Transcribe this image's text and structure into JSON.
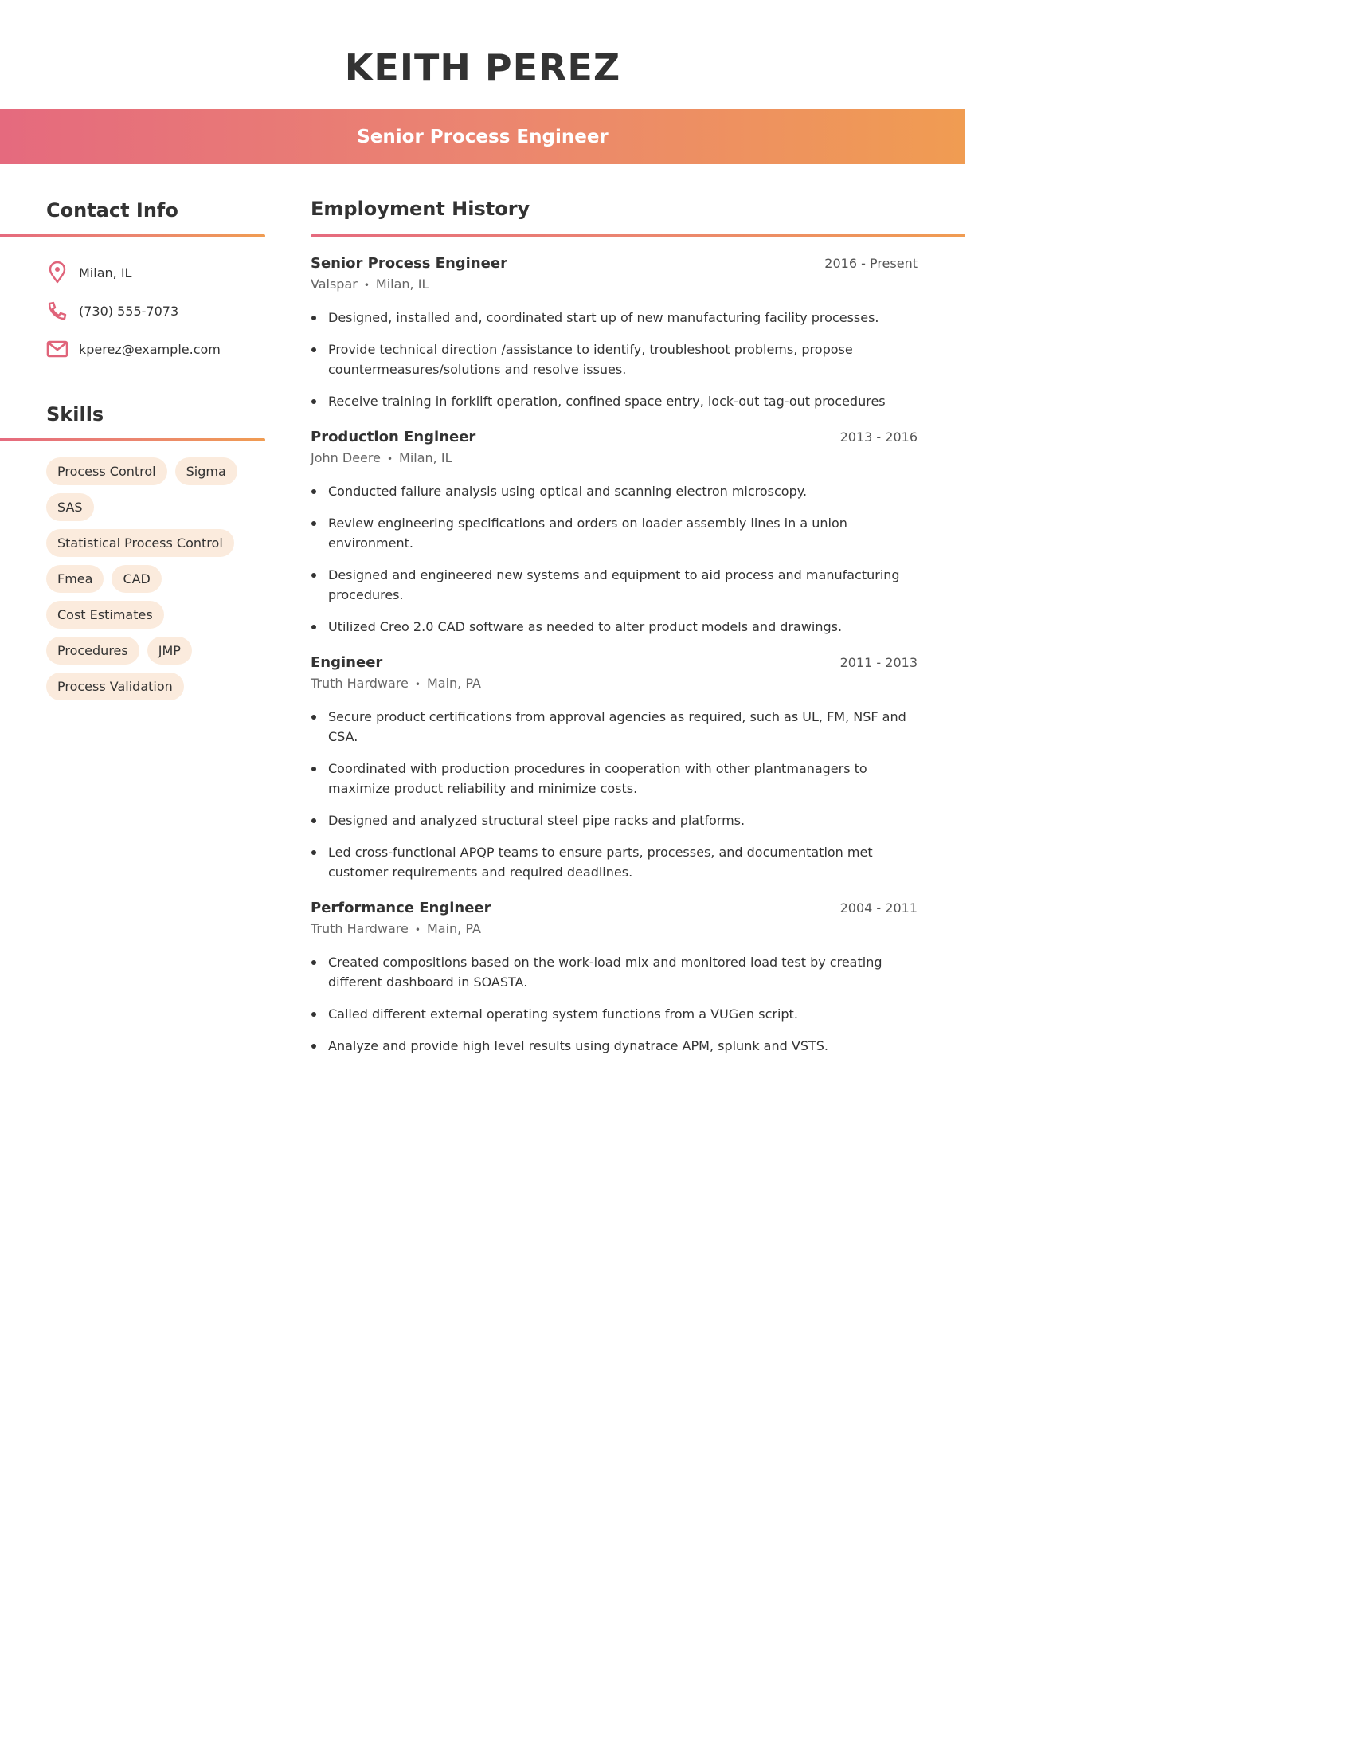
{
  "header": {
    "name": "KEITH PEREZ",
    "title": "Senior Process Engineer"
  },
  "theme": {
    "gradient_start": "#E56A7E",
    "gradient_end": "#F09C52",
    "icon_color": "#E0647A",
    "chip_background": "#FBEBDD",
    "text_color": "#333333"
  },
  "contact": {
    "heading": "Contact Info",
    "items": [
      {
        "icon": "location-pin-icon",
        "text": "Milan, IL"
      },
      {
        "icon": "phone-icon",
        "text": "(730) 555-7073"
      },
      {
        "icon": "mail-icon",
        "text": "kperez@example.com"
      }
    ]
  },
  "skills": {
    "heading": "Skills",
    "items": [
      "Process Control",
      "Sigma",
      "SAS",
      "Statistical Process Control",
      "Fmea",
      "CAD",
      "Cost Estimates",
      "Procedures",
      "JMP",
      "Process Validation"
    ]
  },
  "employment": {
    "heading": "Employment History",
    "separator": "•",
    "jobs": [
      {
        "title": "Senior Process Engineer",
        "dates": "2016 - Present",
        "company": "Valspar",
        "location": "Milan, IL",
        "bullets": [
          "Designed, installed and, coordinated start up of new manufacturing facility processes.",
          "Provide technical direction /assistance to identify, troubleshoot problems, propose countermeasures/solutions and resolve issues.",
          "Receive training in forklift operation, confined space entry, lock-out tag-out procedures"
        ]
      },
      {
        "title": "Production Engineer",
        "dates": "2013 - 2016",
        "company": "John Deere",
        "location": "Milan, IL",
        "bullets": [
          "Conducted failure analysis using optical and scanning electron microscopy.",
          "Review engineering specifications and orders on loader assembly lines in a union environment.",
          "Designed and engineered new systems and equipment to aid process and manufacturing procedures.",
          "Utilized Creo 2.0 CAD software as needed to alter product models and drawings."
        ]
      },
      {
        "title": "Engineer",
        "dates": "2011 - 2013",
        "company": "Truth Hardware",
        "location": "Main, PA",
        "bullets": [
          "Secure product certifications from approval agencies as required, such as UL, FM, NSF and CSA.",
          "Coordinated with production procedures in cooperation with other plantmanagers to maximize product reliability and minimize costs.",
          "Designed and analyzed structural steel pipe racks and platforms.",
          "Led cross-functional APQP teams to ensure parts, processes, and documentation met customer requirements and required deadlines."
        ]
      },
      {
        "title": "Performance Engineer",
        "dates": "2004 - 2011",
        "company": "Truth Hardware",
        "location": "Main, PA",
        "bullets": [
          "Created compositions based on the work-load mix and monitored load test by creating different dashboard in SOASTA.",
          "Called different external operating system functions from a VUGen script.",
          "Analyze and provide high level results using dynatrace APM, splunk and VSTS."
        ]
      }
    ]
  }
}
